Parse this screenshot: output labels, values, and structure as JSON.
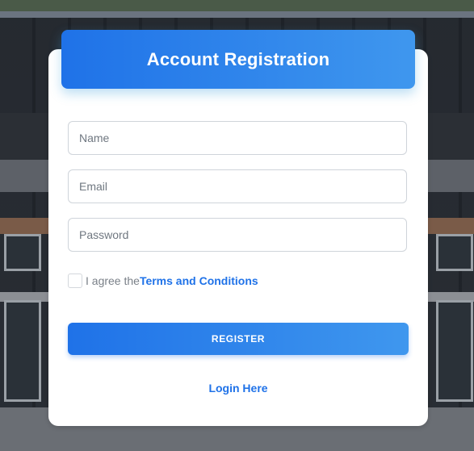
{
  "form": {
    "title": "Account Registration",
    "name_placeholder": "Name",
    "email_placeholder": "Email",
    "password_placeholder": "Password",
    "agree_text": "I agree the",
    "terms_link": "Terms and Conditions",
    "register_label": "REGISTER",
    "login_link": "Login Here"
  },
  "colors": {
    "accent": "#1f72e8",
    "accent_light": "#3f97ee",
    "card": "#ffffff"
  }
}
